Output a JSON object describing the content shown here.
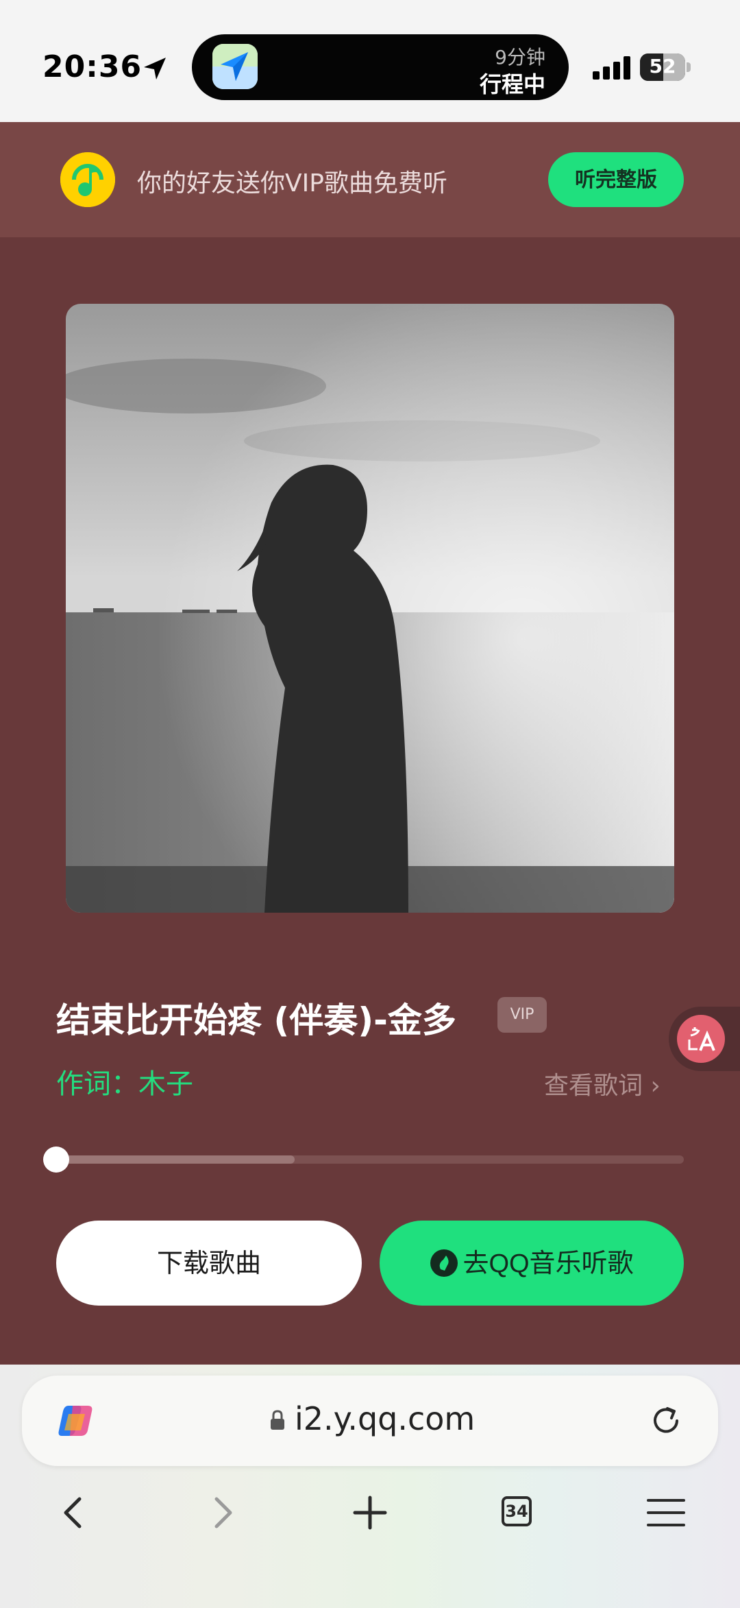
{
  "status_bar": {
    "time": "20:36",
    "island": {
      "line1": "9分钟",
      "line2": "行程中"
    },
    "battery": {
      "level": "52",
      "fraction": 0.52
    }
  },
  "promo_banner": {
    "text": "你的好友送你VIP歌曲免费听",
    "button": "听完整版"
  },
  "song": {
    "title": "结束比开始疼 (伴奏)-金多",
    "vip_badge": "VIP",
    "lyricist": "作词：木子",
    "view_lyrics": "查看歌词 ›",
    "progress": 0.0,
    "buffered": 0.38
  },
  "actions": {
    "download": "下载歌曲",
    "open_app": "去QQ音乐听歌"
  },
  "browser": {
    "url": "i2.y.qq.com",
    "tab_count": "34"
  },
  "colors": {
    "page_bg": "#68393a",
    "banner_bg": "#794746",
    "accent_green": "#1fe07e",
    "lyricist_green": "#23dd7f"
  },
  "icons": [
    "location-arrow-icon",
    "maps-app-icon",
    "signal-icon",
    "battery-icon",
    "qq-music-logo",
    "translate-icon",
    "copilot-icon",
    "lock-icon",
    "reload-icon",
    "back-icon",
    "forward-icon",
    "new-tab-icon",
    "tabs-icon",
    "menu-icon"
  ]
}
